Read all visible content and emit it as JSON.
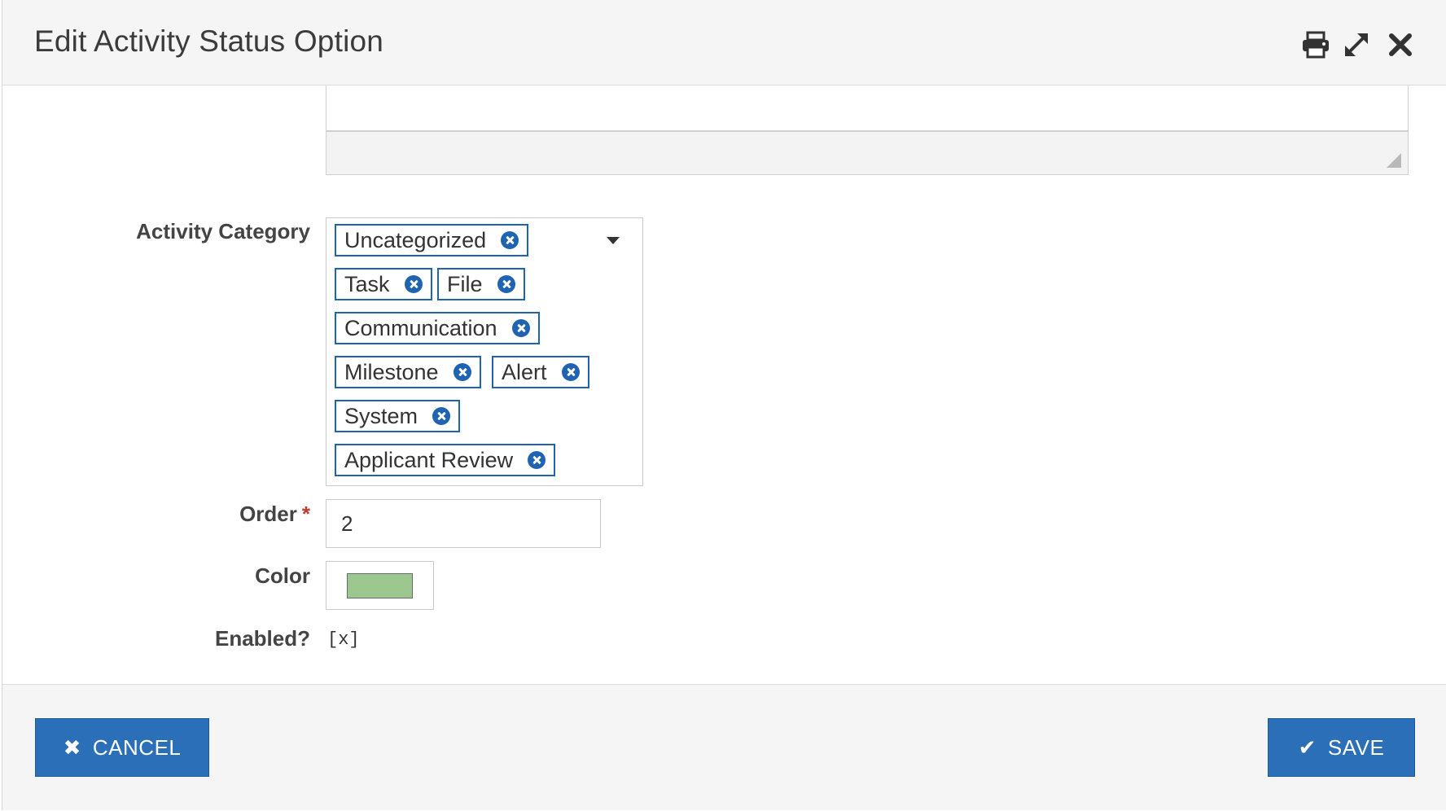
{
  "dialog": {
    "title": "Edit Activity Status Option",
    "header_icons": [
      "print-icon",
      "expand-icon",
      "close-icon"
    ]
  },
  "form": {
    "activity_category": {
      "label": "Activity Category",
      "tags": [
        "Uncategorized",
        "Task",
        "File",
        "Communication",
        "Milestone",
        "Alert",
        "System",
        "Applicant Review"
      ]
    },
    "order": {
      "label": "Order",
      "required_mark": "*",
      "value": "2"
    },
    "color": {
      "label": "Color",
      "value": "#9cc78f"
    },
    "enabled": {
      "label": "Enabled?",
      "value": "[x]"
    }
  },
  "footer": {
    "cancel_label": "CANCEL",
    "save_label": "SAVE",
    "accent_color": "#2a6fb8"
  }
}
